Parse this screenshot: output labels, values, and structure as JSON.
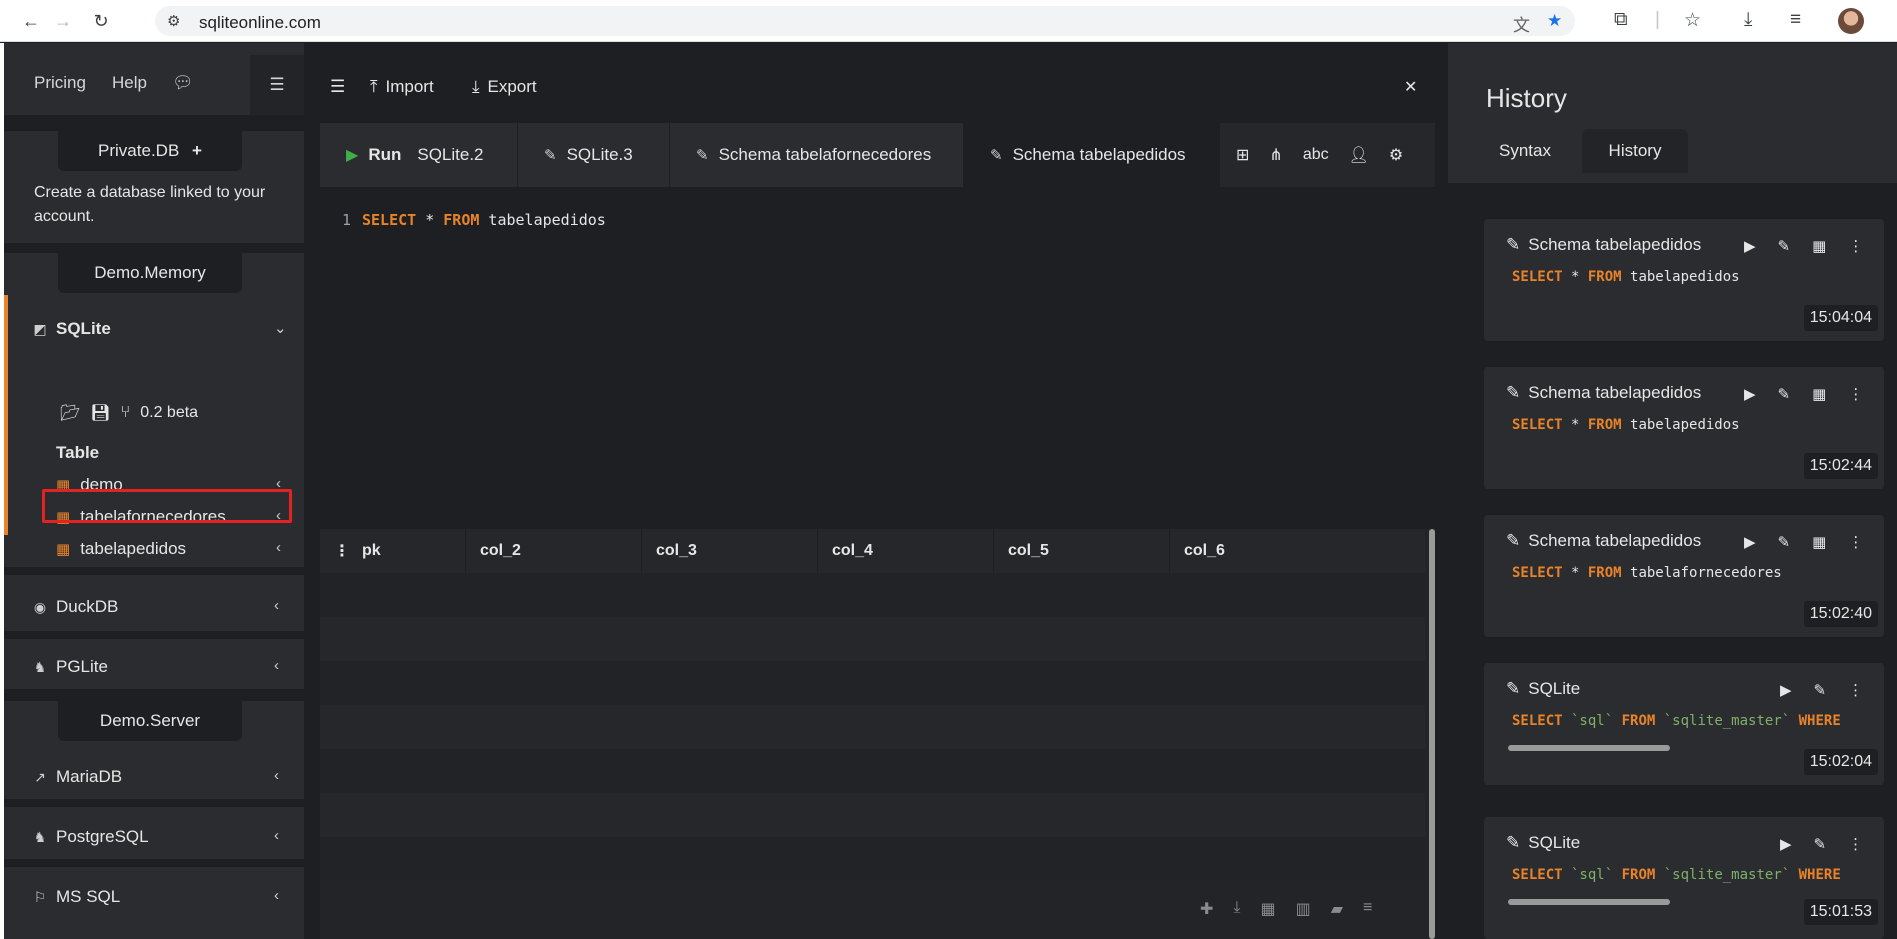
{
  "browser": {
    "url": "sqliteonline.com"
  },
  "sidebar": {
    "top_links": [
      "Pricing",
      "Help"
    ],
    "private_db": "Private.DB",
    "private_text": "Create a database linked to your account.",
    "demo_memory": "Demo.Memory",
    "sqlite": "SQLite",
    "version": "0.2 beta",
    "table_heading": "Table",
    "tables": [
      "demo",
      "tabelafornecedores",
      "tabelapedidos"
    ],
    "duckdb": "DuckDB",
    "pglite": "PGLite",
    "demo_server": "Demo.Server",
    "mariadb": "MariaDB",
    "postgresql": "PostgreSQL",
    "mssql": "MS SQL"
  },
  "toolbar": {
    "import": "Import",
    "export": "Export"
  },
  "tabs": {
    "run": "Run",
    "items": [
      "SQLite.2",
      "SQLite.3",
      "Schema tabelafornecedores",
      "Schema tabelapedidos"
    ]
  },
  "editor": {
    "line": "1",
    "kw1": "SELECT",
    "mid": " * ",
    "kw2": "FROM",
    "table": " tabelapedidos"
  },
  "grid": {
    "columns": [
      "pk",
      "col_2",
      "col_3",
      "col_4",
      "col_5",
      "col_6"
    ]
  },
  "history": {
    "title": "History",
    "tabs": [
      "Syntax",
      "History"
    ],
    "cards": [
      {
        "title": "Schema tabelapedidos",
        "kw1": "SELECT",
        "mid": " * ",
        "kw2": "FROM",
        "rest": " tabelapedidos",
        "time": "15:04:04"
      },
      {
        "title": "Schema tabelapedidos",
        "kw1": "SELECT",
        "mid": " * ",
        "kw2": "FROM",
        "rest": " tabelapedidos",
        "time": "15:02:44"
      },
      {
        "title": "Schema tabelapedidos",
        "kw1": "SELECT",
        "mid": " * ",
        "kw2": "FROM",
        "rest": " tabelafornecedores",
        "time": "15:02:40"
      },
      {
        "title": "SQLite",
        "kw1": "SELECT",
        "s1": " `sql` ",
        "kw2": "FROM",
        "s2": " `sqlite_master` ",
        "kw3": "WHERE",
        "time": "15:02:04"
      },
      {
        "title": "SQLite",
        "kw1": "SELECT",
        "s1": " `sql` ",
        "kw2": "FROM",
        "s2": " `sqlite_master` ",
        "kw3": "WHERE",
        "time": "15:01:53"
      }
    ]
  },
  "colors": {
    "accent": "#e8832a",
    "run_green": "#3fae49",
    "highlight_red": "#e32222"
  }
}
